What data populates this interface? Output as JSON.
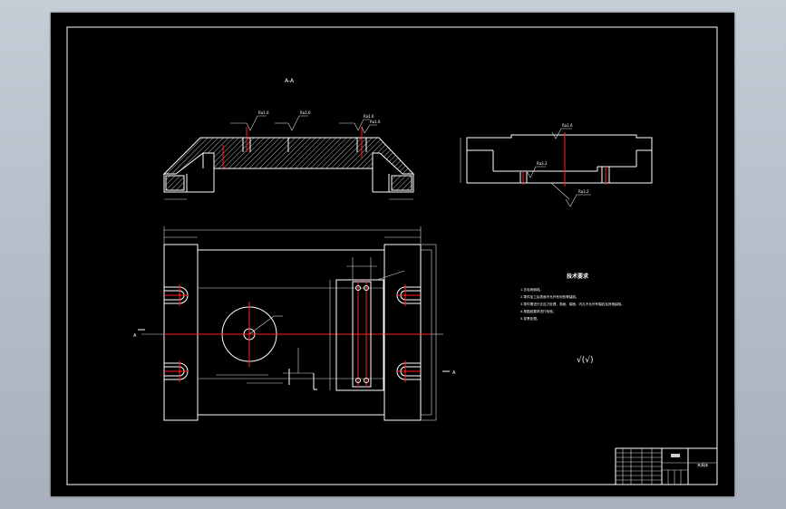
{
  "section_label": "A-A",
  "roughness": {
    "r1": "Ra1.6",
    "r2": "Ra1.6",
    "r3": "Ra1.6",
    "r4": "Ra1.6",
    "side_top": "Ra1.6",
    "side_mid": "Ra3.2",
    "side_bot": "Ra3.2"
  },
  "tech_requirements": {
    "title": "技术要求",
    "lines": [
      "1.去毛刺倒钝。",
      "2.零件加工后表面不允许有划伤等缺陷。",
      "3.零件需进行去应力处理，表面、端面、内孔不允许有裂纹及其他缺陷。",
      "4.按图纸要求进行检验。",
      "5.发黑处理。"
    ],
    "general_roughness": "√(√)"
  },
  "section_markers": {
    "left": "A",
    "right": "A"
  },
  "title_block": {
    "part_name": "夹具体"
  }
}
